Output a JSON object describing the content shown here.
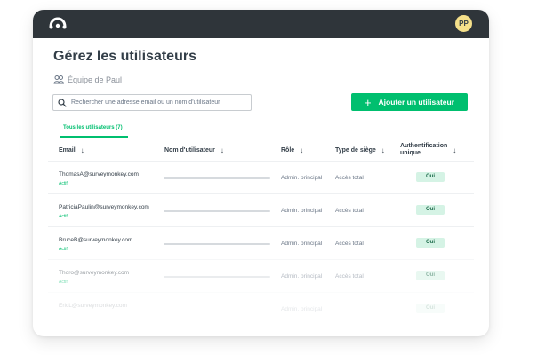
{
  "header": {
    "avatar_initials": "PP"
  },
  "page": {
    "title": "Gérez les utilisateurs",
    "team_name": "Équipe de Paul"
  },
  "search": {
    "placeholder": "Rechercher une adresse email ou un nom d'utilisateur"
  },
  "add_user": {
    "label": "Ajouter un utilisateur",
    "plus": "+"
  },
  "tabs": [
    {
      "label": "Tous les utilisateurs (7)",
      "active": true
    }
  ],
  "table": {
    "columns": {
      "email": "Email",
      "username": "Nom d'utilisateur",
      "role": "Rôle",
      "seat": "Type de siège",
      "sso_line1": "Authentification",
      "sso_line2": "unique"
    },
    "rows": [
      {
        "email": "ThomasA@surveymonkey.com",
        "status": "Actif",
        "role": "Admin. principal",
        "seat": "Accès total",
        "sso": "Oui"
      },
      {
        "email": "PatriciaPaulin@surveymonkey.com",
        "status": "Actif",
        "role": "Admin. principal",
        "seat": "Accès total",
        "sso": "Oui"
      },
      {
        "email": "BruceB@surveymonkey.com",
        "status": "Actif",
        "role": "Admin. principal",
        "seat": "Accès total",
        "sso": "Oui"
      },
      {
        "email": "Thoro@surveymonkey.com",
        "status": "Actif",
        "role": "Admin. principal",
        "seat": "Accès total",
        "sso": "Oui"
      },
      {
        "email": "EricL@surveymonkey.com",
        "status": "",
        "role": "Admin. principal",
        "seat": "",
        "sso": "Oui"
      }
    ]
  },
  "colors": {
    "accent": "#00bf6f",
    "topbar": "#2f353a",
    "text": "#333e48",
    "muted": "#6b7787",
    "badge_bg": "#d5f3e5"
  },
  "icons": {
    "logo": "surveymonkey-logo",
    "team": "team-icon",
    "search": "search-icon",
    "sort": "arrow-down-icon"
  }
}
